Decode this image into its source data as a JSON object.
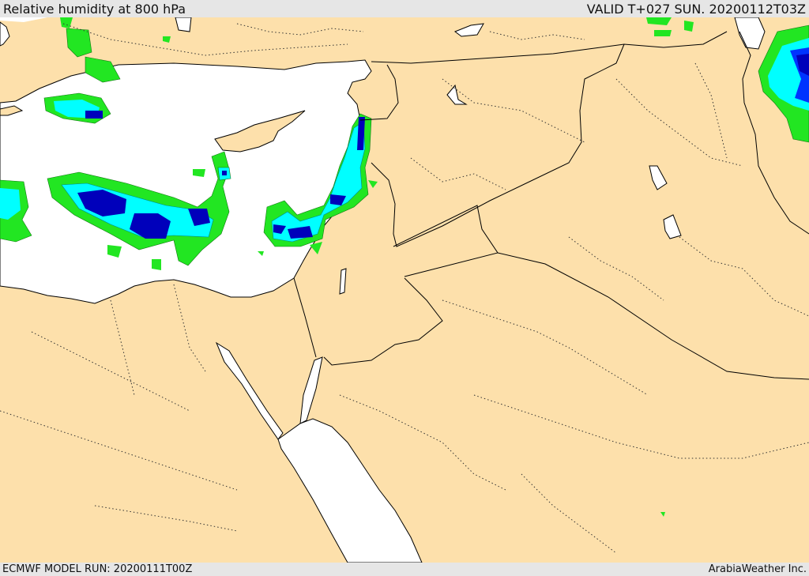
{
  "header": {
    "title": "Relative humidity at 800 hPa",
    "valid": "VALID T+027 SUN. 20200112T03Z"
  },
  "footer": {
    "model_run": "ECMWF MODEL RUN: 20200111T00Z",
    "brand": "ArabiaWeather Inc."
  },
  "colors": {
    "land": "#fde0ab",
    "sea": "#ffffff",
    "header_bg": "#e6e6e6",
    "humidity_low": "#22e622",
    "humidity_mid": "#00ffff",
    "humidity_high": "#0033ff",
    "humidity_max": "#0000bb"
  }
}
